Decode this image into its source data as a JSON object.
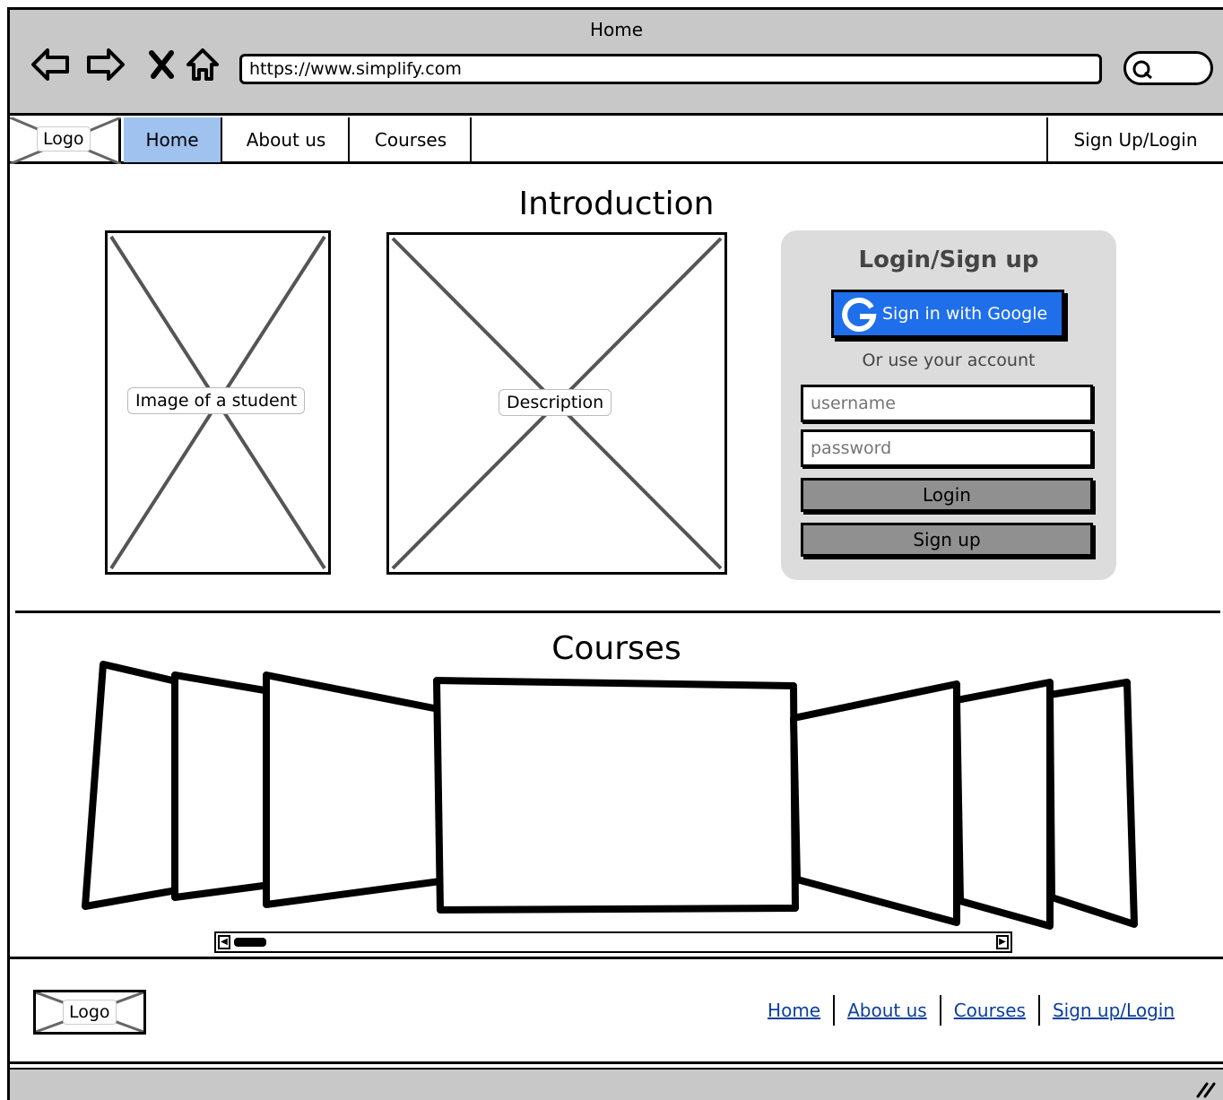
{
  "browser": {
    "title": "Home",
    "url": "https://www.simplify.com",
    "icons": [
      "back-arrow-icon",
      "forward-arrow-icon",
      "close-icon",
      "home-icon",
      "search-icon"
    ]
  },
  "navbar": {
    "logo": "Logo",
    "items": [
      {
        "label": "Home",
        "active": true
      },
      {
        "label": "About us"
      },
      {
        "label": "Courses"
      }
    ],
    "signup": "Sign Up/Login"
  },
  "intro": {
    "title": "Introduction",
    "image_label": "Image of a student",
    "description_label": "Description"
  },
  "login": {
    "title": "Login/Sign up",
    "google_btn": "Sign in with Google",
    "or_text": "Or use your account",
    "username_placeholder": "username",
    "password_placeholder": "password",
    "login_btn": "Login",
    "signup_btn": "Sign up",
    "google_color": "#1f6feb"
  },
  "courses": {
    "title": "Courses"
  },
  "footer": {
    "logo": "Logo",
    "links": [
      "Home",
      "About us",
      "Courses",
      "Sign up/Login"
    ]
  },
  "colors": {
    "chrome": "#c8c8c8",
    "nav_active": "#9fc2ef",
    "panel": "#dcdcdc",
    "button": "#909090",
    "link": "#0b3f9e"
  }
}
